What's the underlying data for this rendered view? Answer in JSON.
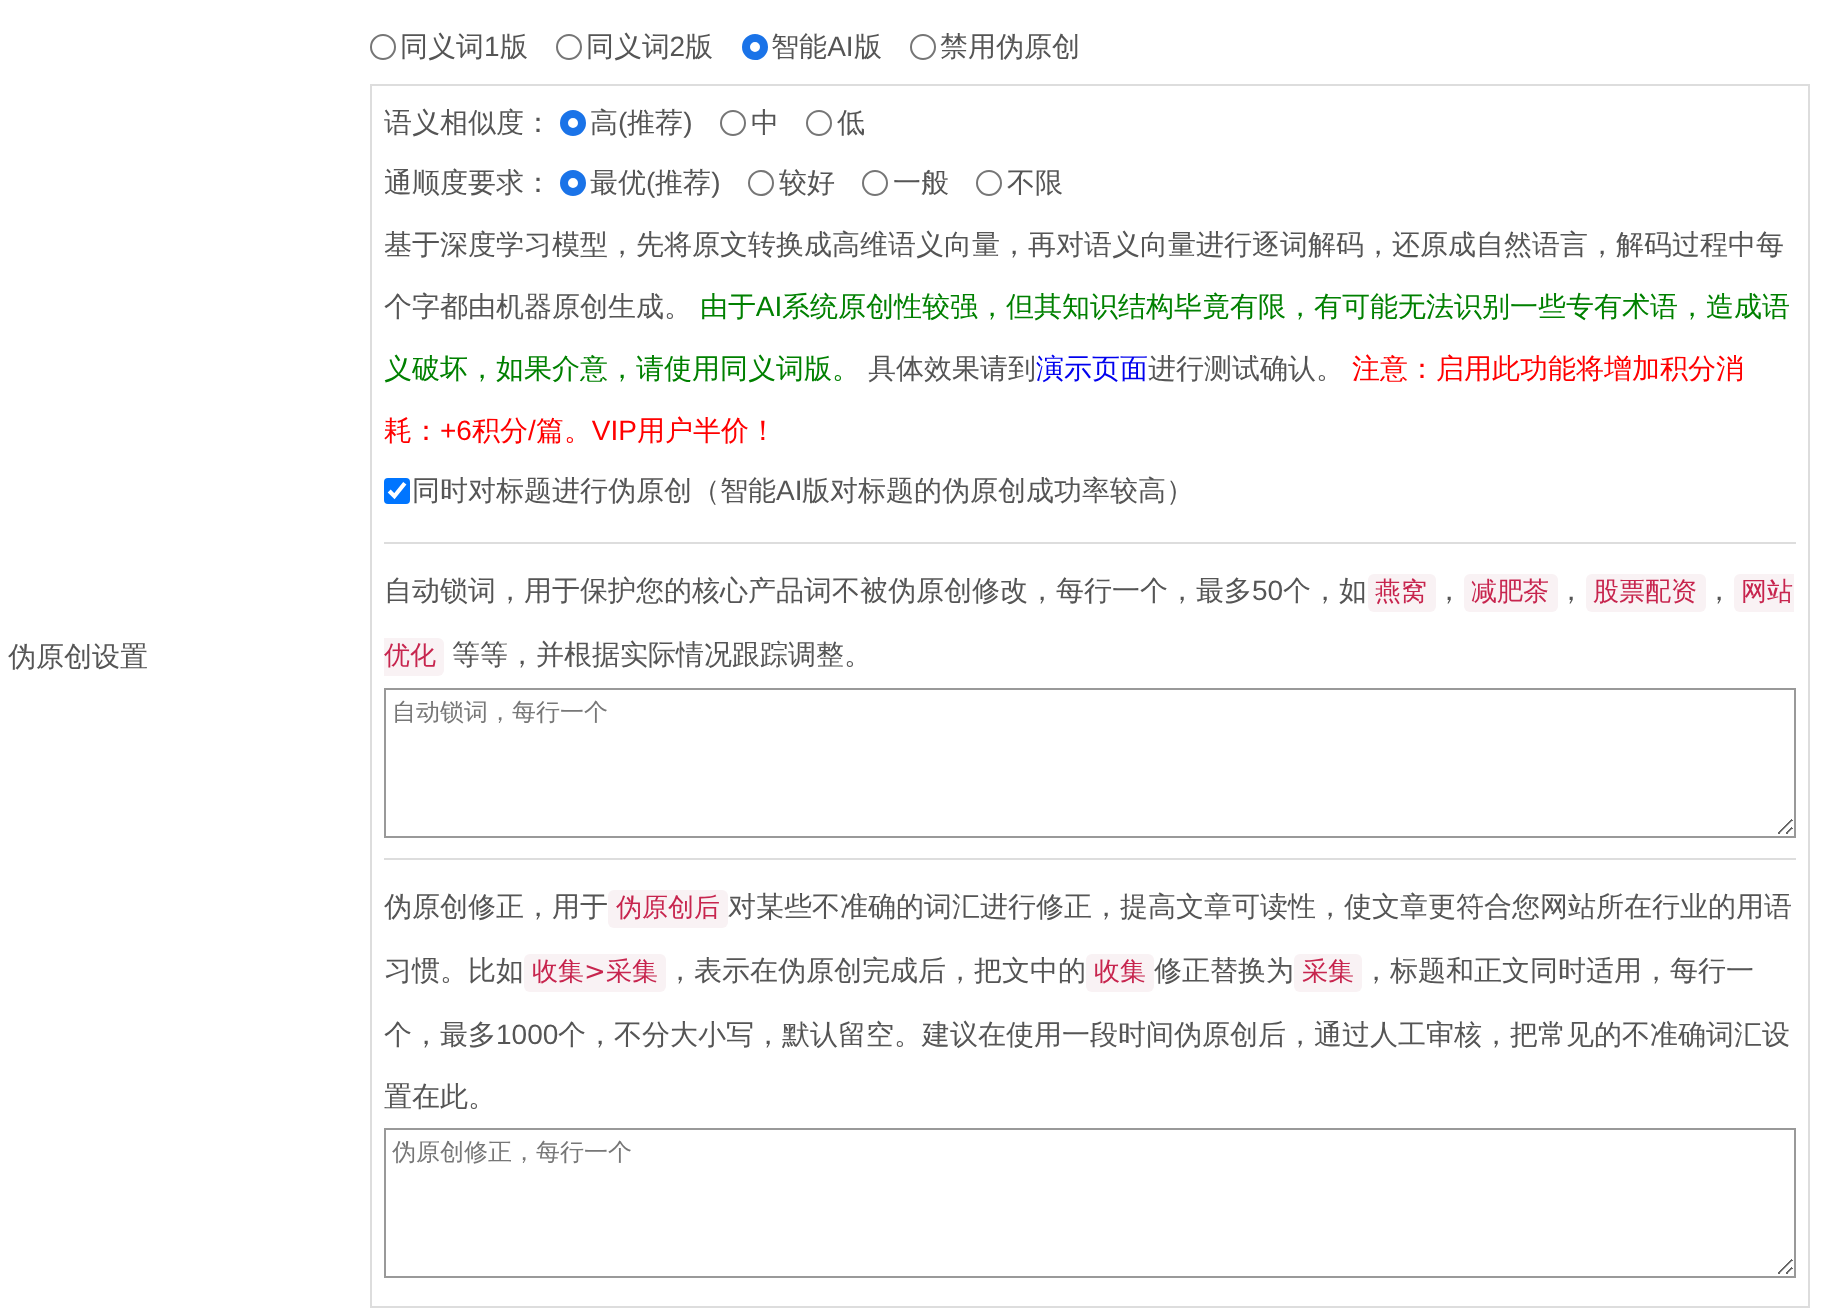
{
  "section_label": "伪原创设置",
  "mode_options": [
    {
      "label": "同义词1版",
      "selected": false
    },
    {
      "label": "同义词2版",
      "selected": false
    },
    {
      "label": "智能AI版",
      "selected": true
    },
    {
      "label": "禁用伪原创",
      "selected": false
    }
  ],
  "similarity": {
    "label": "语义相似度：",
    "options": [
      {
        "label": "高(推荐)",
        "selected": true
      },
      {
        "label": "中",
        "selected": false
      },
      {
        "label": "低",
        "selected": false
      }
    ]
  },
  "fluency": {
    "label": "通顺度要求：",
    "options": [
      {
        "label": "最优(推荐)",
        "selected": true
      },
      {
        "label": "较好",
        "selected": false
      },
      {
        "label": "一般",
        "selected": false
      },
      {
        "label": "不限",
        "selected": false
      }
    ]
  },
  "ai_description": [
    {
      "kind": "plain",
      "text": "基于深度学习模型，先将原文转换成高维语义向量，再对语义向量进行逐词解码，还原成自然语言，解码过程中每个字都由机器原创生成。 "
    },
    {
      "kind": "caution",
      "text": "由于AI系统原创性较强，但其知识结构毕竟有限，有可能无法识别一些专有术语，造成语义破坏，如果介意，请使用同义词版。"
    },
    {
      "kind": "plain",
      "text": " 具体效果请到"
    },
    {
      "kind": "link",
      "text": "演示页面"
    },
    {
      "kind": "plain",
      "text": "进行测试确认。 "
    },
    {
      "kind": "warning",
      "text": "注意：启用此功能将增加积分消耗：+6积分/篇。VIP用户半价！"
    }
  ],
  "title_option": {
    "label": "同时对标题进行伪原创（智能AI版对标题的伪原创成功率较高）",
    "checked": true
  },
  "lock_words": {
    "description": [
      {
        "kind": "plain",
        "text": "自动锁词，用于保护您的核心产品词不被伪原创修改，每行一个，最多50个，如"
      },
      {
        "kind": "tag",
        "text": "燕窝"
      },
      {
        "kind": "plain",
        "text": "，"
      },
      {
        "kind": "tag",
        "text": "减肥茶"
      },
      {
        "kind": "plain",
        "text": "，"
      },
      {
        "kind": "tag",
        "text": "股票配资"
      },
      {
        "kind": "plain",
        "text": "，"
      },
      {
        "kind": "tag",
        "text": "网站优化"
      },
      {
        "kind": "plain",
        "text": " 等等，并根据实际情况跟踪调整。"
      }
    ],
    "placeholder": "自动锁词，每行一个"
  },
  "correction": {
    "description": [
      {
        "kind": "plain",
        "text": "伪原创修正，用于"
      },
      {
        "kind": "tag",
        "text": "伪原创后"
      },
      {
        "kind": "plain",
        "text": "对某些不准确的词汇进行修正，提高文章可读性，使文章更符合您网站所在行业的用语习惯。比如"
      },
      {
        "kind": "tag",
        "text": "收集>采集"
      },
      {
        "kind": "plain",
        "text": "，表示在伪原创完成后，把文中的"
      },
      {
        "kind": "tag",
        "text": "收集"
      },
      {
        "kind": "plain",
        "text": "修正替换为"
      },
      {
        "kind": "tag",
        "text": "采集"
      },
      {
        "kind": "plain",
        "text": "，标题和正文同时适用，每行一个，最多1000个，不分大小写，默认留空。建议在使用一段时间伪原创后，通过人工审核，把常见的不准确词汇设置在此。"
      }
    ],
    "placeholder": "伪原创修正，每行一个"
  }
}
